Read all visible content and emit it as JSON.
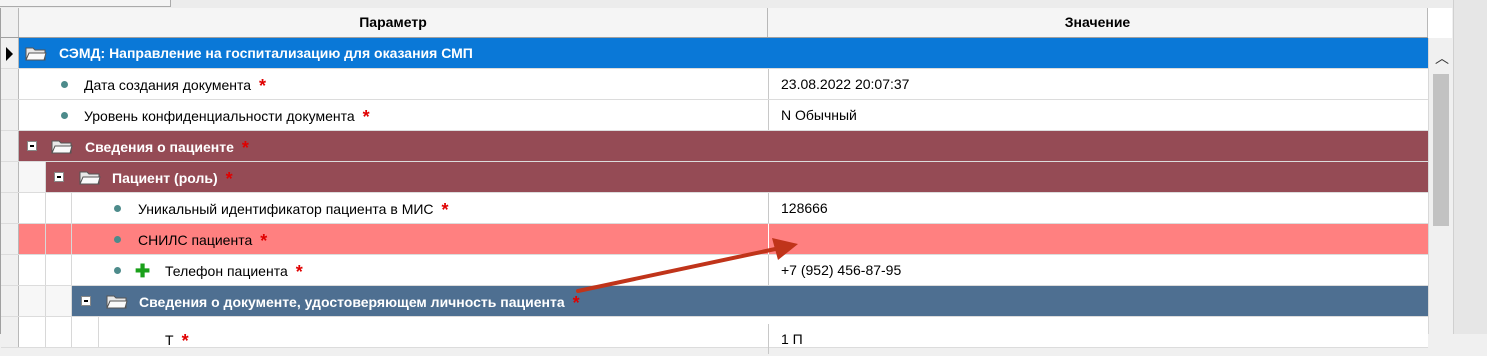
{
  "grid": {
    "columns": {
      "param": "Параметр",
      "value": "Значение"
    },
    "rows": [
      {
        "kind": "group",
        "label": "СЭМД: Направление на госпитализацию для оказания СМП",
        "required": false,
        "value": "",
        "color": "#0a78d7"
      },
      {
        "kind": "item",
        "label": "Дата создания документа",
        "required": true,
        "value": "23.08.2022 20:07:37"
      },
      {
        "kind": "item",
        "label": "Уровень конфиденциальности документа",
        "required": true,
        "value": "N Обычный"
      },
      {
        "kind": "group",
        "label": "Сведения о пациенте",
        "required": true,
        "value": "",
        "color": "#954b55"
      },
      {
        "kind": "group",
        "label": "Пациент (роль)",
        "required": true,
        "value": "",
        "color": "#954b55"
      },
      {
        "kind": "item",
        "label": "Уникальный идентификатор пациента в МИС",
        "required": true,
        "value": "128666"
      },
      {
        "kind": "item",
        "label": "СНИЛС пациента",
        "required": true,
        "value": "",
        "color": "#ff8080"
      },
      {
        "kind": "item",
        "label": "Телефон пациента",
        "required": true,
        "value": "+7 (952) 456-87-95"
      },
      {
        "kind": "group",
        "label": "Сведения о документе, удостоверяющем личность пациента",
        "required": true,
        "value": "",
        "color": "#4e6f91"
      },
      {
        "kind": "item",
        "label": "Т",
        "required": true,
        "value": "1 П"
      }
    ]
  },
  "icons": {
    "folder": "folder-open-icon",
    "status": "status-dot-icon",
    "add": "plus-icon",
    "expand": "minus-box-icon"
  },
  "annotation_color": "#c0341a"
}
